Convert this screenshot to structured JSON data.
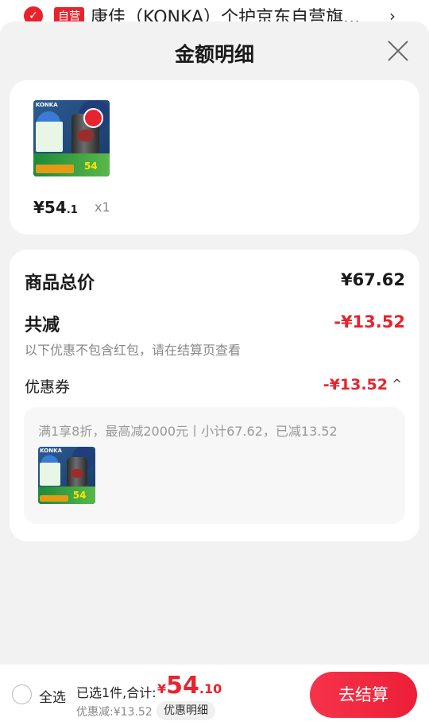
{
  "background_item": {
    "self_run_tag": "自营",
    "shop_name": "康佳（KONKA）个护京东自营旗...",
    "arrow": "›"
  },
  "sheet": {
    "title": "金额明细"
  },
  "product": {
    "brand_text": "KONKA",
    "price_symbol": "¥",
    "price_int": "54",
    "price_dec": ".1",
    "quantity": "x1",
    "thumb_price": "54"
  },
  "summary": {
    "total_label": "商品总价",
    "total_value": "¥67.62",
    "reduce_label": "共减",
    "reduce_value": "-¥13.52",
    "reduce_note": "以下优惠不包含红包，请在结算页查看",
    "coupon_label": "优惠券",
    "coupon_value": "-¥13.52",
    "coupon_chevron": "^",
    "coupon_desc": "满1享8折，最高减2000元丨小计67.62，已减13.52"
  },
  "bottom_bar": {
    "select_all": "全选",
    "selected_text": "已选1件,合计:",
    "sum_currency": "¥",
    "sum_int": "54",
    "sum_dec": ".10",
    "discount_text": "优惠减:¥13.52",
    "detail_button": "优惠明细",
    "checkout_button": "去结算"
  },
  "colors": {
    "accent_red": "#e8232d",
    "background": "#f2f2f2"
  }
}
